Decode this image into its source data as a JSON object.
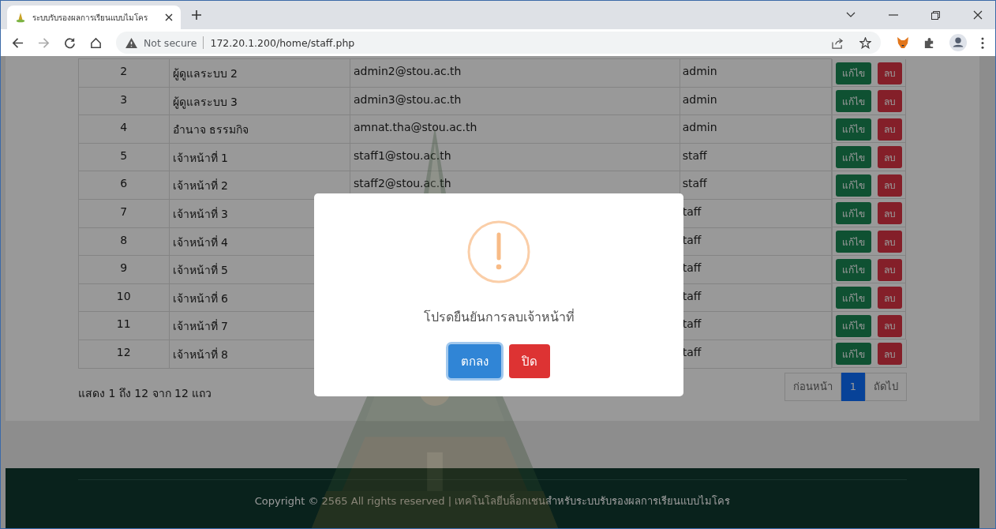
{
  "browser": {
    "tab_title": "ระบบรับรองผลการเรียนแบบไมโคร",
    "security": "Not secure",
    "url": "172.20.1.200/home/staff.php"
  },
  "table": {
    "rows": [
      {
        "no": "2",
        "name": "ผู้ดูแลระบบ 2",
        "email": "admin2@stou.ac.th",
        "role": "admin",
        "actions": [
          "แก้ไข",
          "ลบ"
        ]
      },
      {
        "no": "3",
        "name": "ผู้ดูแลระบบ 3",
        "email": "admin3@stou.ac.th",
        "role": "admin",
        "actions": [
          "แก้ไข",
          "ลบ"
        ]
      },
      {
        "no": "4",
        "name": "อำนาจ ธรรมกิจ",
        "email": "amnat.tha@stou.ac.th",
        "role": "admin",
        "actions": [
          "แก้ไข",
          "ลบ"
        ]
      },
      {
        "no": "5",
        "name": "เจ้าหน้าที่ 1",
        "email": "staff1@stou.ac.th",
        "role": "staff",
        "actions": [
          "แก้ไข",
          "ลบ"
        ]
      },
      {
        "no": "6",
        "name": "เจ้าหน้าที่ 2",
        "email": "staff2@stou.ac.th",
        "role": "staff",
        "actions": [
          "แก้ไข",
          "ลบ"
        ]
      },
      {
        "no": "7",
        "name": "เจ้าหน้าที่ 3",
        "role": "taff",
        "actions": [
          "แก้ไข",
          "ลบ"
        ]
      },
      {
        "no": "8",
        "name": "เจ้าหน้าที่ 4",
        "role": "taff",
        "actions": [
          "แก้ไข",
          "ลบ"
        ]
      },
      {
        "no": "9",
        "name": "เจ้าหน้าที่ 5",
        "role": "taff",
        "actions": [
          "แก้ไข",
          "ลบ"
        ]
      },
      {
        "no": "10",
        "name": "เจ้าหน้าที่ 6",
        "role": "taff",
        "actions": [
          "แก้ไข",
          "ลบ"
        ]
      },
      {
        "no": "11",
        "name": "เจ้าหน้าที่ 7",
        "role": "taff",
        "actions": [
          "แก้ไข",
          "ลบ"
        ]
      },
      {
        "no": "12",
        "name": "เจ้าหน้าที่ 8",
        "role": "taff",
        "actions": [
          "แก้ไข",
          "ลบ"
        ]
      }
    ]
  },
  "summary": "แสดง 1 ถึง 12 จาก 12 แถว",
  "pagination": [
    {
      "label": "ก่อนหน้า",
      "selected": false
    },
    {
      "label": "1",
      "selected": true
    },
    {
      "label": "ถัดไป",
      "selected": false
    }
  ],
  "dialog": {
    "message": "โปรดยืนยันการลบเจ้าหน้าที่",
    "buttons": [
      {
        "label": "ตกลง",
        "kind": "confirm"
      },
      {
        "label": "ปิด",
        "kind": "cancel"
      }
    ]
  },
  "footer": "Copyright © 2565 All rights reserved | เทคโนโลยีบล็อกเชนสำหรับระบบรับรองผลการเรียนแบบไมโคร"
}
